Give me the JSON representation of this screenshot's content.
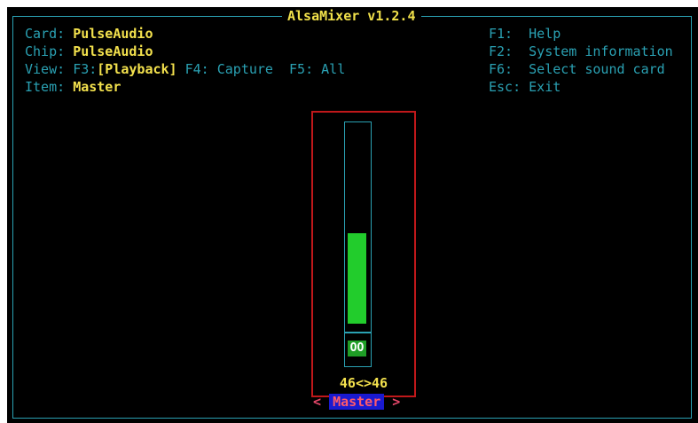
{
  "app": {
    "title": "AlsaMixer v1.2.4"
  },
  "info": {
    "card_label": "Card:",
    "card_value": "PulseAudio",
    "chip_label": "Chip:",
    "chip_value": "PulseAudio",
    "view_label": "View:",
    "view_f3_key": "F3:",
    "view_f3_value": "[Playback]",
    "view_f4": "F4: Capture",
    "view_f5": "F5: All",
    "item_label": "Item:",
    "item_value": "Master"
  },
  "help": {
    "f1": "F1:  Help",
    "f2": "F2:  System information",
    "f6": "F6:  Select sound card",
    "esc": "Esc: Exit"
  },
  "control": {
    "name": "Master",
    "left_marker": "<",
    "right_marker": ">",
    "mute_indicator": "OO",
    "volume_text": "46<>46",
    "level_fraction": 0.46
  },
  "colors": {
    "background": "#000000",
    "border": "#2aa1b3",
    "value_text": "#f3e14d",
    "focus_box": "#c0181a",
    "volume_bar": "#22cc2c",
    "name_highlight": "#1a1ad0"
  }
}
